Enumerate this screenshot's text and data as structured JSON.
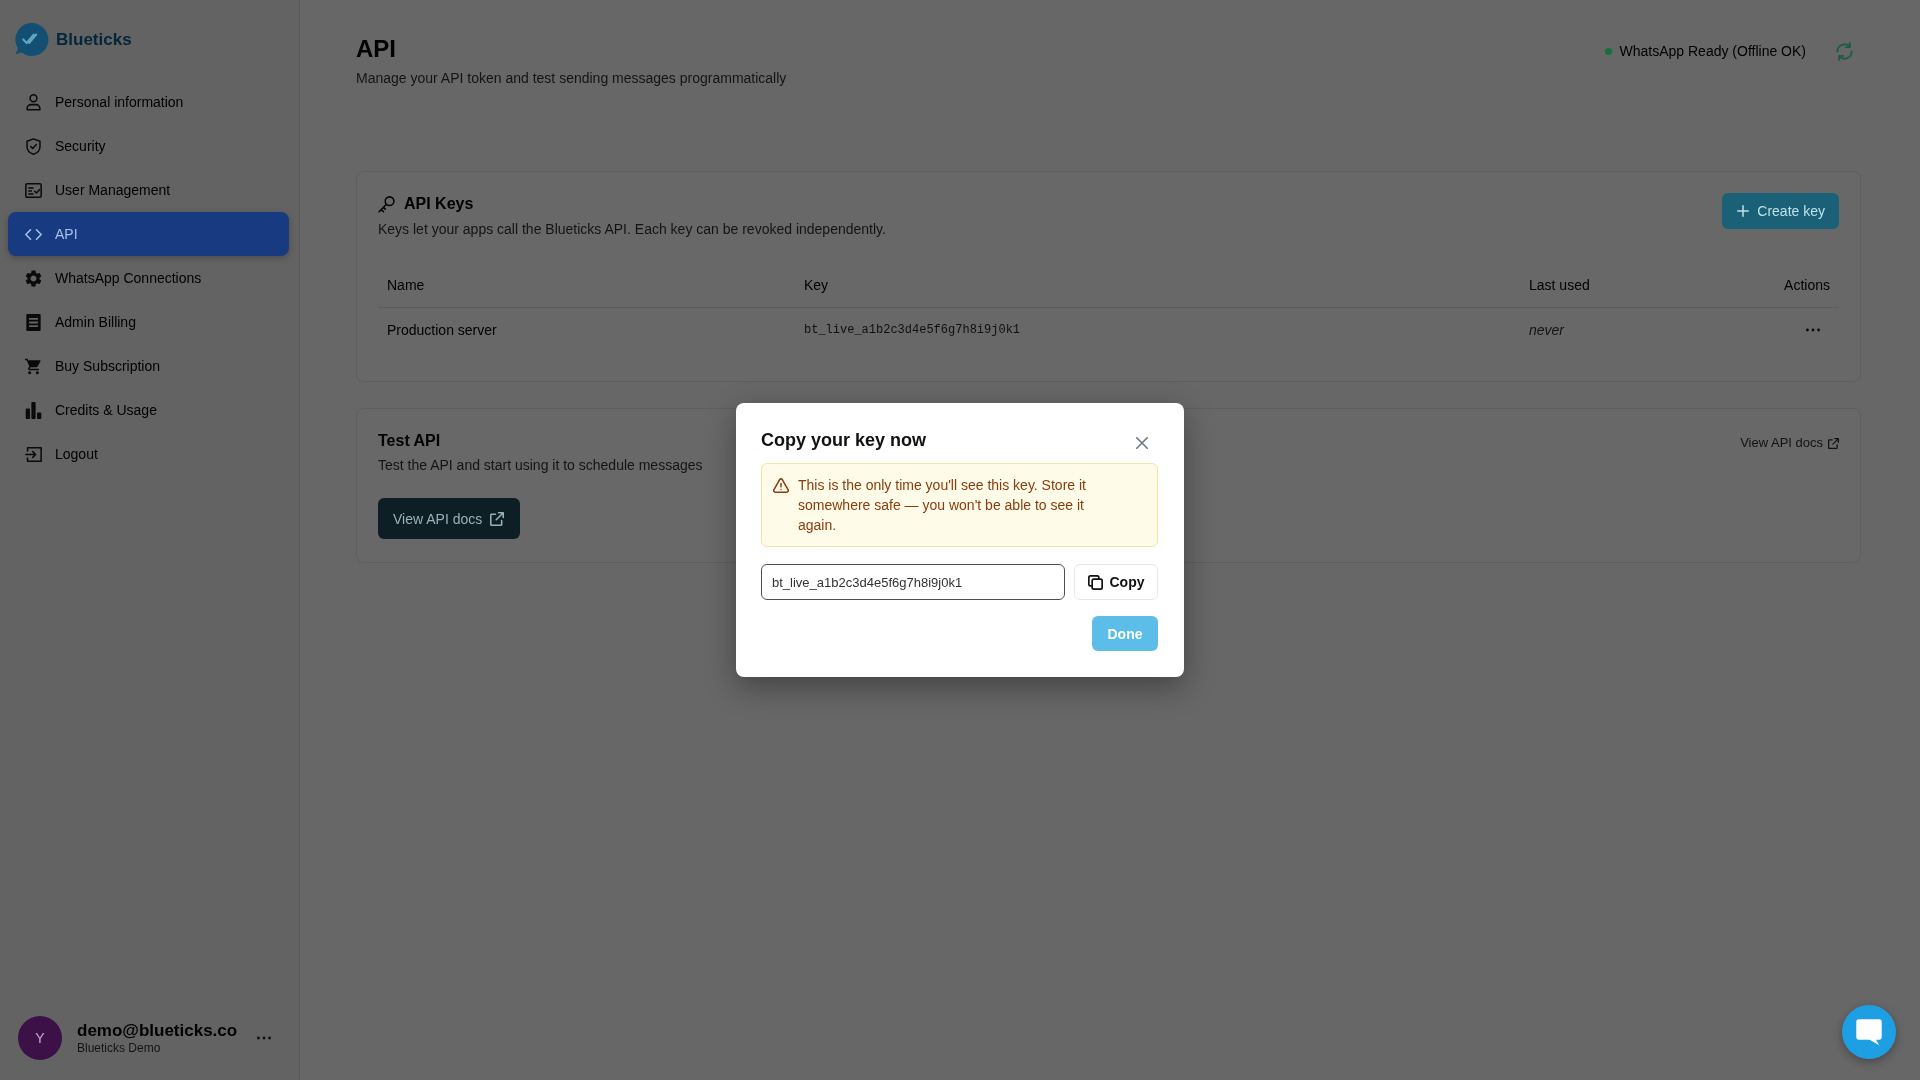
{
  "brand": {
    "name": "Blueticks"
  },
  "sidebar": {
    "items": [
      {
        "label": "Personal information",
        "selected": false
      },
      {
        "label": "Security",
        "selected": false
      },
      {
        "label": "User Management",
        "selected": false
      },
      {
        "label": "API",
        "selected": true
      },
      {
        "label": "WhatsApp Connections",
        "selected": false
      },
      {
        "label": "Admin Billing",
        "selected": false
      },
      {
        "label": "Buy Subscription",
        "selected": false
      },
      {
        "label": "Credits & Usage",
        "selected": false
      },
      {
        "label": "Logout",
        "selected": false
      }
    ]
  },
  "account": {
    "avatar_initial": "Y",
    "email": "demo@blueticks.co",
    "name": "Blueticks Demo"
  },
  "header": {
    "title": "API",
    "subtitle": "Manage your API token and test sending messages programmatically",
    "status": "WhatsApp Ready (Offline OK)"
  },
  "api_keys": {
    "title": "API Keys",
    "subtitle": "Keys let your apps call the Blueticks API. Each key can be revoked independently.",
    "create_button": "Create key",
    "table": {
      "columns": [
        "Name",
        "Key",
        "Last used",
        "Actions"
      ],
      "rows": [
        {
          "name": "Production server",
          "key": "bt_live_a1b2c3d4e5f6g7h8i9j0k1",
          "last_used": "never"
        }
      ]
    }
  },
  "test_api": {
    "title": "Test API",
    "subtitle": "Test the API and start using it to schedule messages",
    "docs_button": "View API docs",
    "docs_link": "View API docs"
  },
  "dialog": {
    "title": "Copy your key now",
    "warning": "This is the only time you'll see this key. Store it somewhere safe — you won't be able to see it again.",
    "key_value": "bt_live_a1b2c3d4e5f6g7h8i9j0k1",
    "copy_button": "Copy",
    "done_button": "Done"
  }
}
